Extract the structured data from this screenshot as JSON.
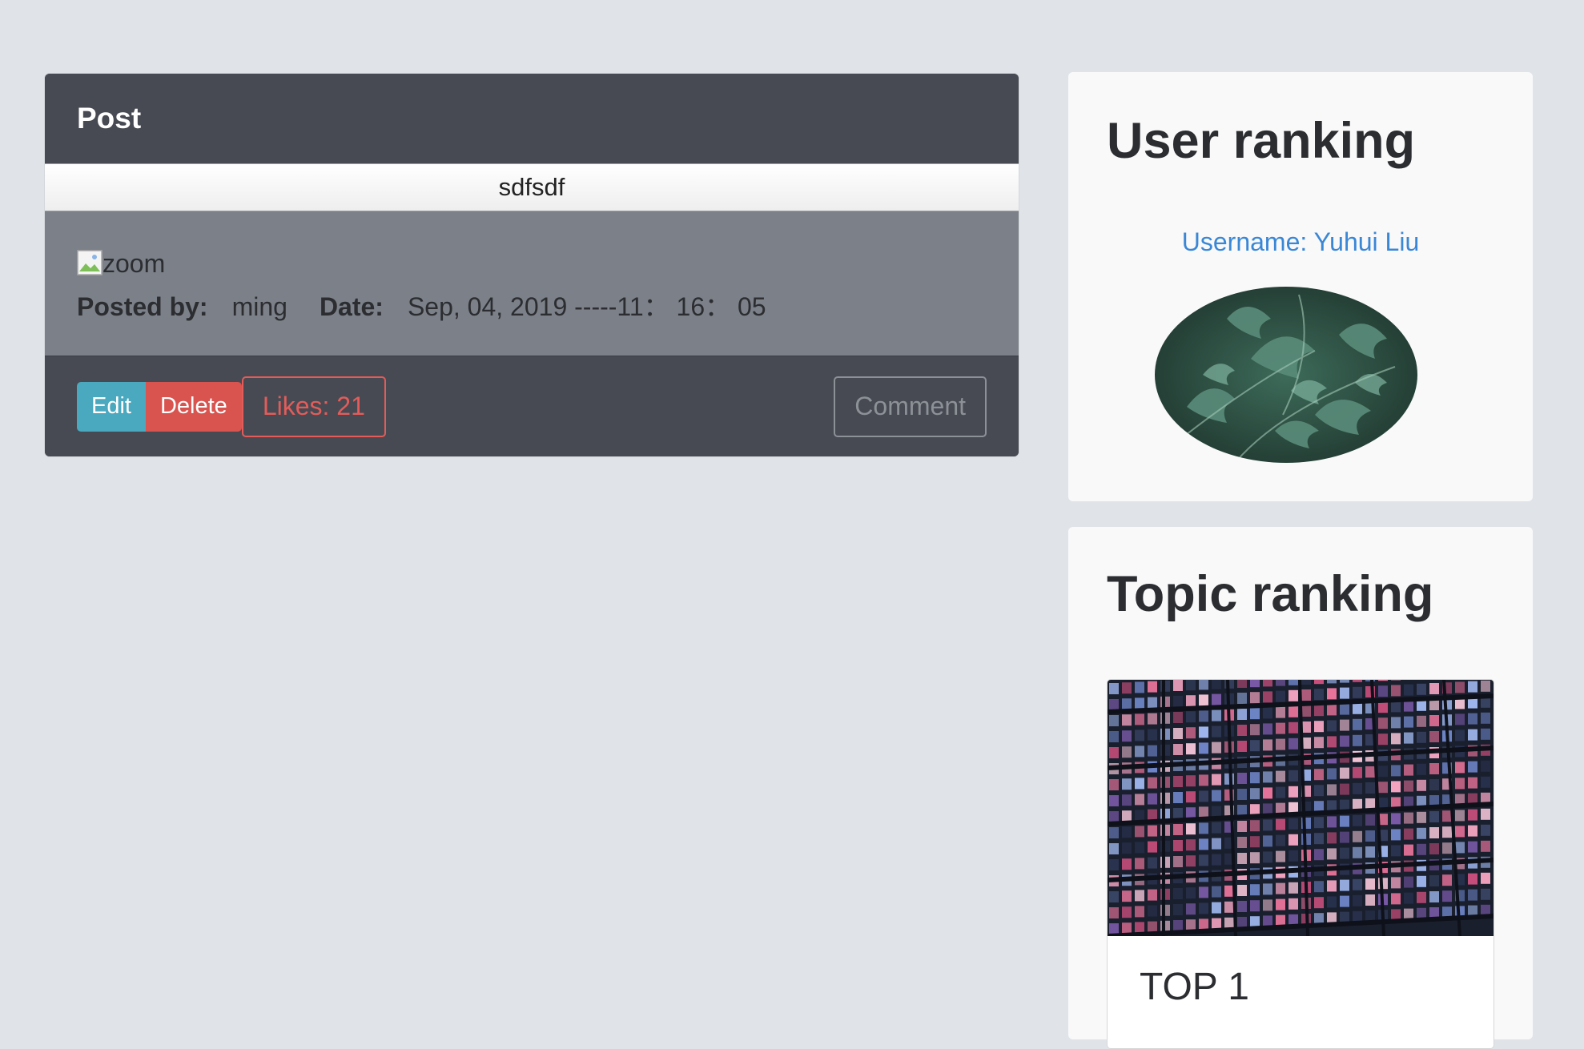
{
  "post": {
    "header_title": "Post",
    "subject": "sdfsdf",
    "image_alt": "zoom",
    "posted_by_label": "Posted by:",
    "posted_by_value": "ming",
    "date_label": "Date:",
    "date_value": "Sep, 04, 2019 -----11： 16： 05",
    "buttons": {
      "edit": "Edit",
      "delete": "Delete",
      "likes": "Likes: 21",
      "comment": "Comment"
    }
  },
  "sidebar": {
    "user_ranking": {
      "title": "User ranking",
      "username_text": "Username: Yuhui Liu"
    },
    "topic_ranking": {
      "title": "Topic ranking",
      "items": [
        {
          "label": "TOP 1"
        }
      ]
    }
  },
  "colors": {
    "page_bg": "#e0e4e8",
    "card_dark": "#474a52",
    "card_body": "#7c8189",
    "edit_button": "#4aa8bf",
    "delete_button": "#d9534f",
    "likes_outline": "#e35c5a",
    "link_blue": "#3a87d6",
    "sidebar_card": "#f9f9f9"
  },
  "icons": {
    "broken_image": "broken-image-icon"
  }
}
